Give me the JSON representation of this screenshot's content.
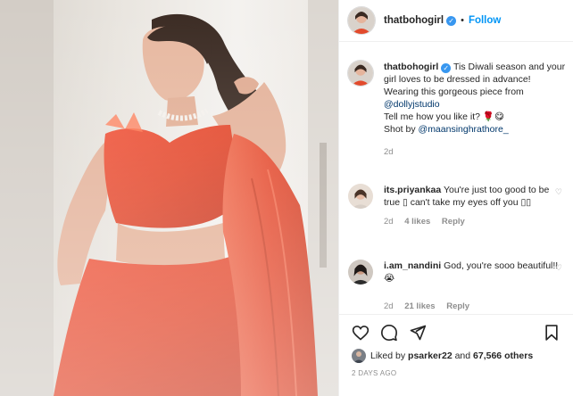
{
  "header": {
    "username": "thatbohogirl",
    "separator": "•",
    "follow_label": "Follow"
  },
  "caption": {
    "username": "thatbohogirl",
    "line1": "Tis Diwali season and your girl loves to be dressed in advance!",
    "line2": "Wearing this gorgeous piece from",
    "mention1": "@dollyjstudio",
    "line3": "Tell me how you like it? 🌹😋",
    "line4_prefix": "Shot by",
    "mention2": "@maansinghrathore_",
    "time": "2d"
  },
  "comments": [
    {
      "username": "its.priyankaa",
      "text": "You're just too good to be true ▯ can't take my eyes off you ▯▯",
      "time": "2d",
      "likes": "4 likes",
      "reply": "Reply"
    },
    {
      "username": "i.am_nandini",
      "text": "God, you're sooo beautiful!!😭",
      "time": "2d",
      "likes": "21 likes",
      "reply": "Reply"
    }
  ],
  "actions": {
    "like_icon": "heart-icon",
    "comment_icon": "comment-icon",
    "share_icon": "share-icon",
    "save_icon": "bookmark-icon"
  },
  "likes": {
    "prefix": "Liked by",
    "user": "psarker22",
    "conj": "and",
    "count": "67,566 others"
  },
  "timestamp": "2 DAYS AGO",
  "colors": {
    "accent": "#0095f6",
    "verified": "#3897f0",
    "saree": "#e2462a"
  }
}
